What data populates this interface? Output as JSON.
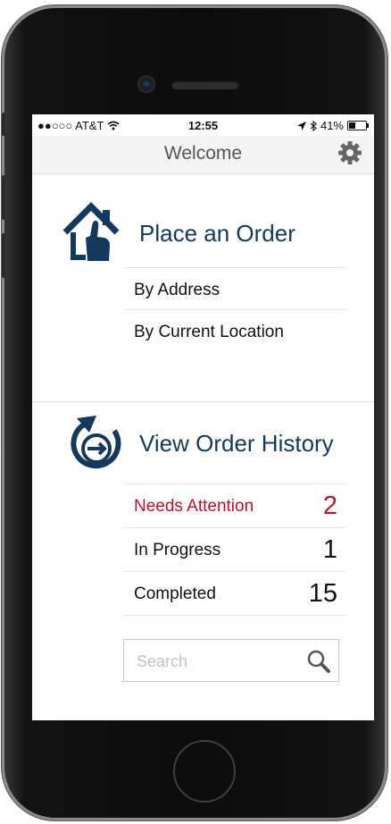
{
  "status_bar": {
    "carrier": "●●○○○ AT&T",
    "time": "12:55",
    "battery": "41%",
    "battery_level": 0.41
  },
  "nav": {
    "title": "Welcome"
  },
  "place_order": {
    "title": "Place an Order",
    "options": [
      "By Address",
      "By Current Location"
    ]
  },
  "order_history": {
    "title": "View Order History",
    "rows": [
      {
        "label": "Needs Attention",
        "count": "2",
        "color": "#b5152c"
      },
      {
        "label": "In Progress",
        "count": "1",
        "color": "#111111"
      },
      {
        "label": "Completed",
        "count": "15",
        "color": "#111111"
      }
    ]
  },
  "search": {
    "placeholder": "Search"
  },
  "colors": {
    "brand": "#15395b",
    "alert": "#b5152c"
  },
  "icons": [
    "wifi-icon",
    "location-arrow-icon",
    "bluetooth-icon",
    "battery-icon",
    "gear-icon",
    "home-touch-icon",
    "history-icon",
    "search-icon"
  ]
}
